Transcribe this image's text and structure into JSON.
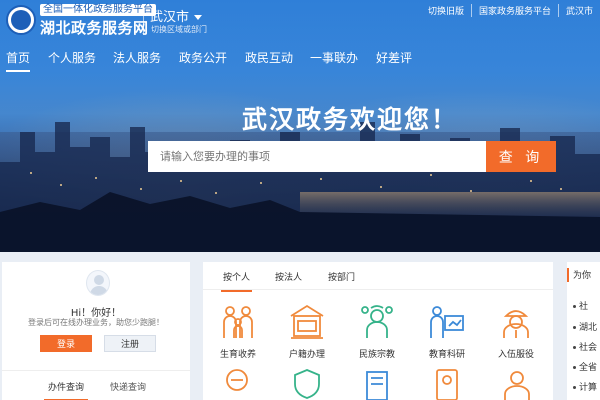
{
  "header": {
    "slogan": "全国一体化政务服务平台",
    "platform_name": "湖北政务服务网",
    "city": "武汉市",
    "city_sub": "切换区域或部门",
    "links": [
      "切换旧版",
      "国家政务服务平台",
      "武汉市"
    ]
  },
  "nav": {
    "items": [
      "首页",
      "个人服务",
      "法人服务",
      "政务公开",
      "政民互动",
      "一事联办",
      "好差评"
    ]
  },
  "hero": {
    "welcome": "武汉政务欢迎您！",
    "search_placeholder": "请输入您要办理的事项",
    "search_button": "查 询"
  },
  "user_panel": {
    "greeting": "Hi！你好！",
    "tip": "登录后可在线办理业务，助您少跑腿！",
    "login": "登录",
    "register": "注册",
    "tabs": [
      "办件查询",
      "快递查询"
    ]
  },
  "service_panel": {
    "tabs": [
      "按个人",
      "按法人",
      "按部门"
    ],
    "items": [
      {
        "label": "生育收养",
        "icon": "family-icon"
      },
      {
        "label": "户籍办理",
        "icon": "household-register-icon"
      },
      {
        "label": "民族宗教",
        "icon": "ethnic-icon"
      },
      {
        "label": "教育科研",
        "icon": "education-icon"
      },
      {
        "label": "入伍服役",
        "icon": "military-icon"
      }
    ]
  },
  "right_panel": {
    "title": "为你",
    "items": [
      "社",
      "湖北",
      "社会",
      "全省",
      "计算"
    ]
  },
  "colors": {
    "accent": "#f26b2a",
    "brand_blue": "#1d5fb8",
    "icon_orange": "#f08a3c",
    "icon_green": "#36b38a",
    "icon_blue": "#3c8ad8"
  }
}
